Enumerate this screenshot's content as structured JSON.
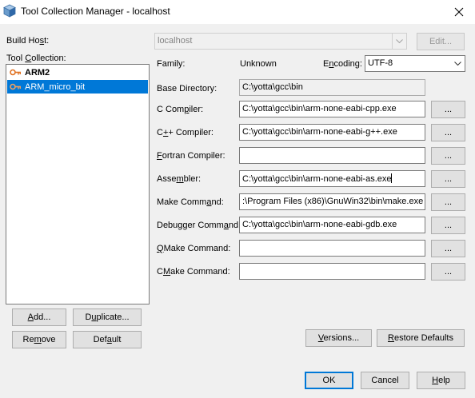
{
  "window": {
    "title": "Tool Collection Manager - localhost"
  },
  "build_host": {
    "label": "Build Host:",
    "value": "localhost",
    "edit_button": "Edit..."
  },
  "tool_collection": {
    "label": "Tool Collection:",
    "items": [
      {
        "label": "ARM2",
        "bold": true,
        "selected": false
      },
      {
        "label": "ARM_micro_bit",
        "bold": false,
        "selected": true
      }
    ],
    "add_button": "Add...",
    "duplicate_button": "Duplicate...",
    "remove_button": "Remove",
    "default_button": "Default"
  },
  "family": {
    "label": "Family:",
    "value": "Unknown"
  },
  "encoding": {
    "label": "Encoding:",
    "value": "UTF-8"
  },
  "fields": {
    "base_directory": {
      "label": "Base Directory:",
      "value": "C:\\yotta\\gcc\\bin"
    },
    "c_compiler": {
      "label": "C Compiler:",
      "value": "C:\\yotta\\gcc\\bin\\arm-none-eabi-cpp.exe"
    },
    "cpp_compiler": {
      "label": "C++ Compiler:",
      "value": "C:\\yotta\\gcc\\bin\\arm-none-eabi-g++.exe"
    },
    "fortran_compiler": {
      "label": "Fortran Compiler:",
      "value": ""
    },
    "assembler": {
      "label": "Assembler:",
      "value": "C:\\yotta\\gcc\\bin\\arm-none-eabi-as.exe"
    },
    "make_command": {
      "label": "Make Command:",
      "value": ":\\Program Files (x86)\\GnuWin32\\bin\\make.exe"
    },
    "debugger_command": {
      "label": "Debugger Command:",
      "value": "C:\\yotta\\gcc\\bin\\arm-none-eabi-gdb.exe"
    },
    "qmake_command": {
      "label": "QMake Command:",
      "value": ""
    },
    "cmake_command": {
      "label": "CMake Command:",
      "value": ""
    }
  },
  "browse_label": "...",
  "versions_button": "Versions...",
  "restore_defaults_button": "Restore Defaults",
  "ok_button": "OK",
  "cancel_button": "Cancel",
  "help_button": "Help",
  "icons": {
    "app": "netbeans-cube-icon",
    "close": "close-icon",
    "tool": "key-tool-icon",
    "dropdown": "chevron-down-icon"
  },
  "colors": {
    "selection": "#0078d7",
    "tool_icon": "#e07020"
  }
}
